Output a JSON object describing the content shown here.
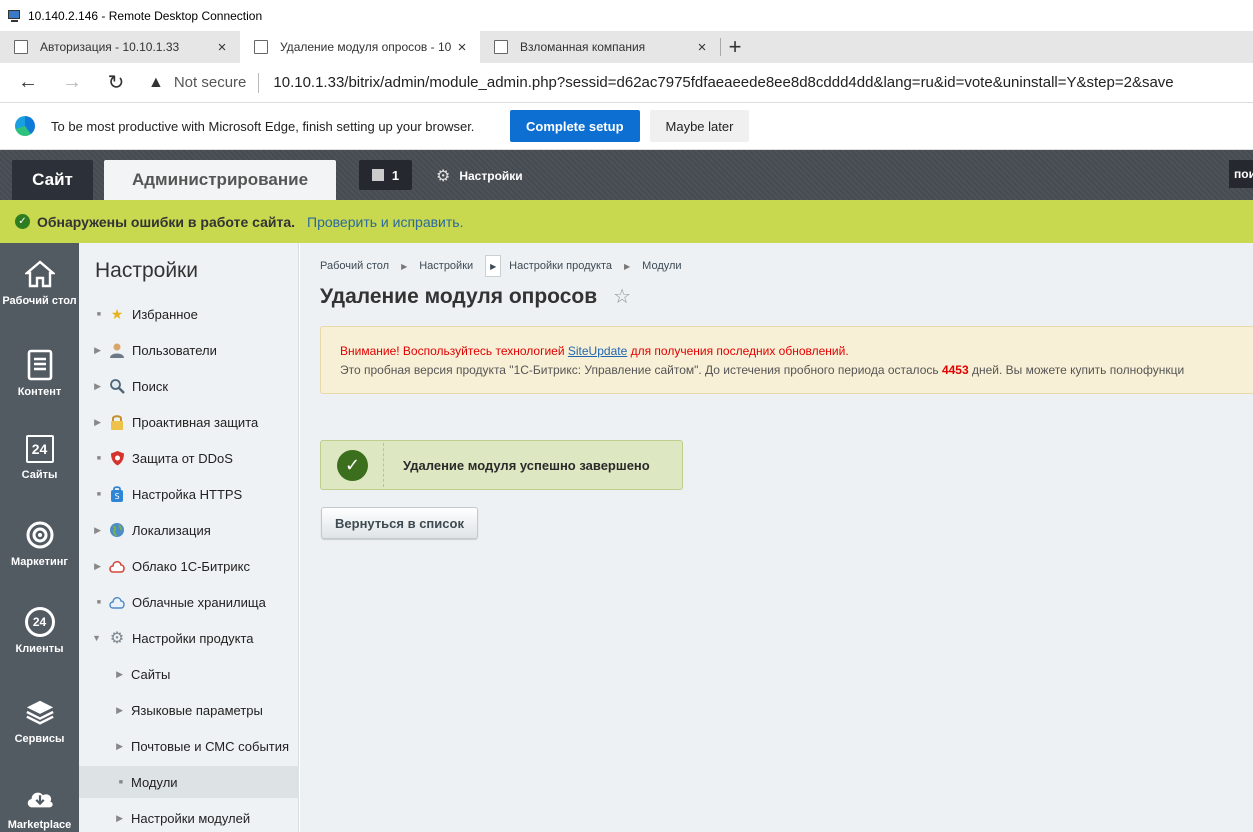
{
  "rdp": {
    "title": "10.140.2.146 - Remote Desktop Connection"
  },
  "browser": {
    "tabs": [
      {
        "label": "Авторизация - 10.10.1.33",
        "close": "×"
      },
      {
        "label": "Удаление модуля опросов - 10",
        "close": "×"
      },
      {
        "label": "Взломанная компания",
        "close": "×"
      }
    ],
    "new_tab": "+",
    "nav": {
      "back": "←",
      "forward": "→",
      "reload": "↻"
    },
    "security_icon": "▲",
    "security_label": "Not secure",
    "url": "10.10.1.33/bitrix/admin/module_admin.php?sessid=d62ac7975fdfaeaeede8ee8d8cddd4dd&lang=ru&id=vote&uninstall=Y&step=2&save"
  },
  "promo": {
    "text": "To be most productive with Microsoft Edge, finish setting up your browser.",
    "complete": "Complete setup",
    "later": "Maybe later"
  },
  "topbar": {
    "site": "Сайт",
    "admin": "Администрирование",
    "notif_count": "1",
    "settings": "Настройки",
    "search": "пои"
  },
  "errorbar": {
    "text": "Обнаружены ошибки в работе сайта.",
    "link": "Проверить и исправить."
  },
  "rail": {
    "items": [
      {
        "label": "Рабочий стол",
        "icon": "home-icon"
      },
      {
        "label": "Контент",
        "icon": "document-icon"
      },
      {
        "label": "Сайты",
        "icon": "calendar-24-icon",
        "glyph": "24"
      },
      {
        "label": "Маркетинг",
        "icon": "target-icon"
      },
      {
        "label": "Клиенты",
        "icon": "clients-24-icon",
        "glyph": "24"
      },
      {
        "label": "Сервисы",
        "icon": "layers-icon"
      },
      {
        "label": "Marketplace",
        "icon": "cloud-download-icon"
      }
    ]
  },
  "menu": {
    "title": "Настройки",
    "items": [
      {
        "label": "Избранное",
        "mark": "dot",
        "icon": "star-icon"
      },
      {
        "label": "Пользователи",
        "mark": "arrow",
        "icon": "user-icon"
      },
      {
        "label": "Поиск",
        "mark": "arrow",
        "icon": "search-icon"
      },
      {
        "label": "Проактивная защита",
        "mark": "arrow",
        "icon": "lock-icon"
      },
      {
        "label": "Защита от DDoS",
        "mark": "dot",
        "icon": "shield-icon"
      },
      {
        "label": "Настройка HTTPS",
        "mark": "dot",
        "icon": "https-icon"
      },
      {
        "label": "Локализация",
        "mark": "arrow",
        "icon": "globe-icon"
      },
      {
        "label": "Облако 1С-Битрикс",
        "mark": "arrow",
        "icon": "cloud-icon"
      },
      {
        "label": "Облачные хранилища",
        "mark": "dot",
        "icon": "storage-icon"
      },
      {
        "label": "Настройки продукта",
        "mark": "open",
        "icon": "gear-icon"
      },
      {
        "label": "Сайты",
        "mark": "arrow",
        "sub": true
      },
      {
        "label": "Языковые параметры",
        "mark": "arrow",
        "sub": true
      },
      {
        "label": "Почтовые и СМС события",
        "mark": "arrow",
        "sub": true
      },
      {
        "label": "Модули",
        "mark": "dot",
        "sub": true,
        "selected": true
      },
      {
        "label": "Настройки модулей",
        "mark": "arrow",
        "sub": true
      }
    ]
  },
  "breadcrumbs": [
    "Рабочий стол",
    "Настройки",
    "Настройки продукта",
    "Модули"
  ],
  "page": {
    "title": "Удаление модуля опросов",
    "warning": {
      "prefix": "Внимание! Воспользуйтесь технологией ",
      "link": "SiteUpdate",
      "suffix": " для получения последних обновлений.",
      "line2_before": "Это пробная версия продукта \"1С-Битрикс: Управление сайтом\". До истечения пробного периода осталось ",
      "days": "4453",
      "line2_after": " дней. Вы можете купить полнофункци"
    },
    "success_message": "Удаление модуля успешно завершено",
    "back_button": "Вернуться в список"
  },
  "colors": {
    "error_bar": "#c8d84f",
    "accent_blue": "#0e6fd2",
    "success_green": "#3b6e1d",
    "warning_red": "#e10000"
  }
}
